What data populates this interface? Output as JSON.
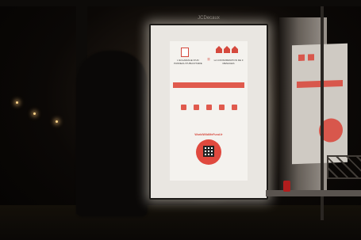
{
  "poster": {
    "brand": "JCDecaux",
    "headline_left": "L'ECLAIRAGE D'UN PANNEAU PUBLICITAIRE",
    "equals": "=",
    "headline_right": "LA CONSOMMATION DE 3 MENAGES",
    "website": "WorldWildlifeFund.fr"
  },
  "right_poster": {
    "label": ""
  },
  "colors": {
    "accent": "#e05a4d",
    "poster_bg": "#f4f2ee"
  }
}
